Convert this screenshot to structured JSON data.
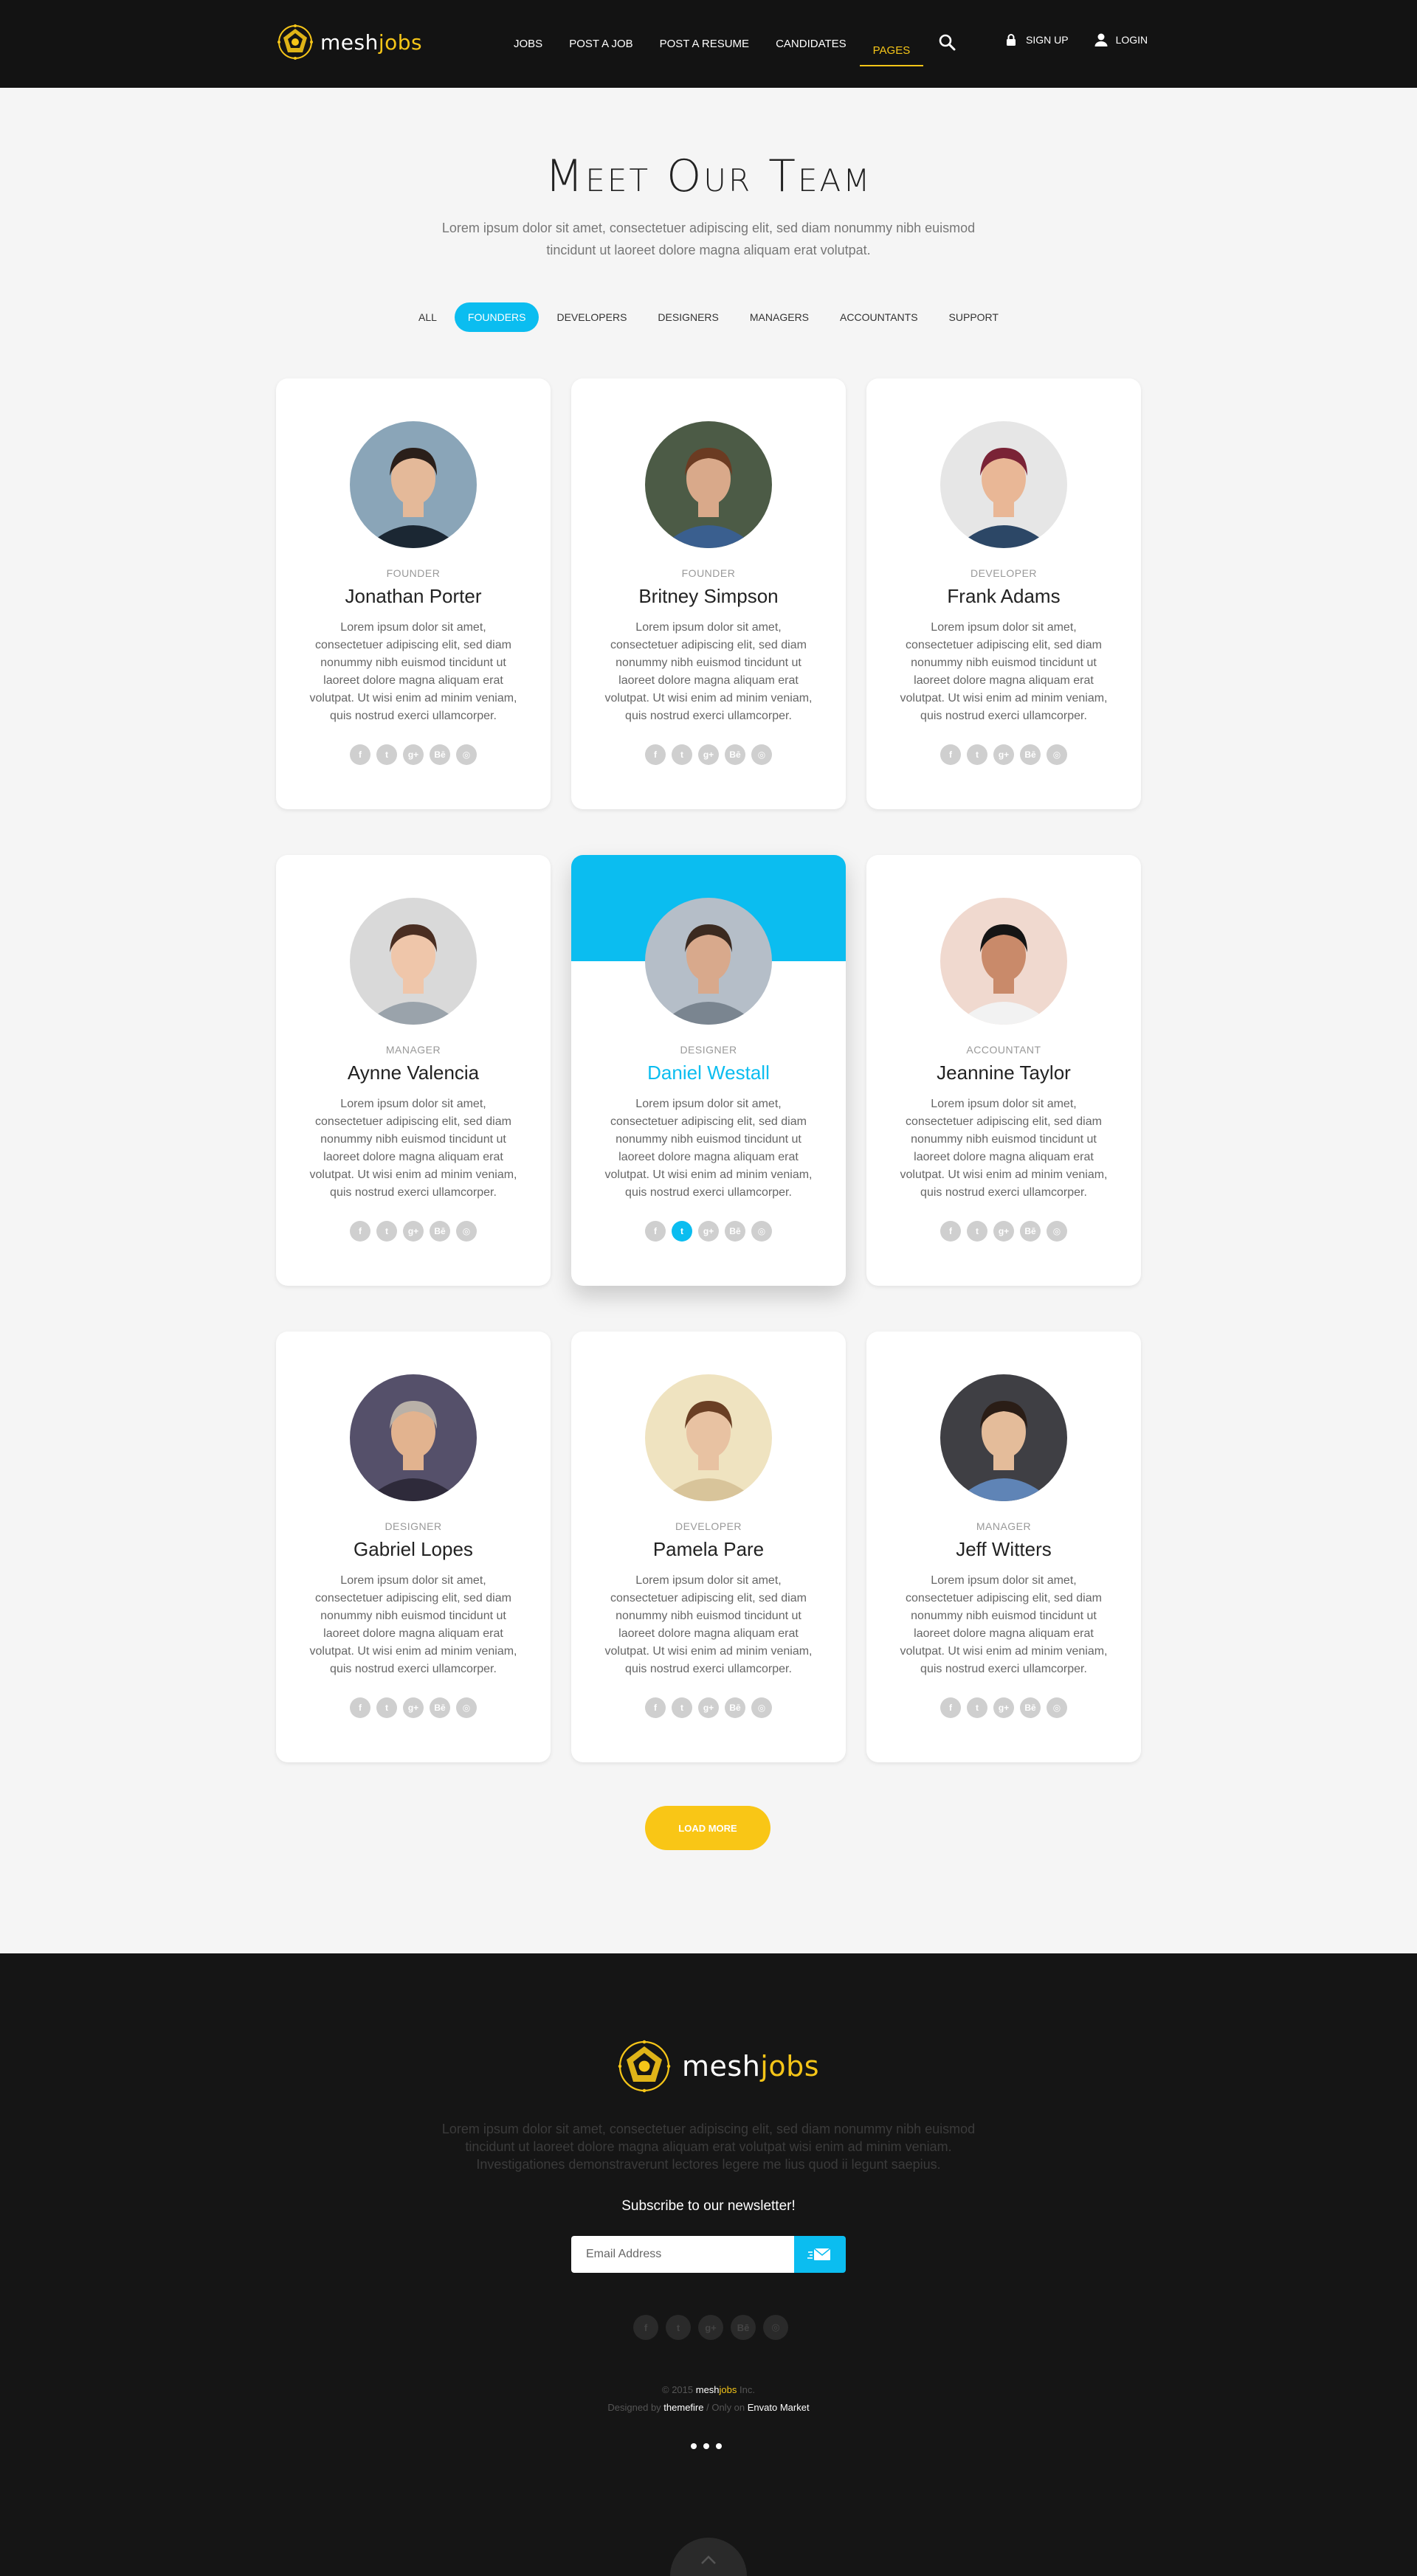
{
  "brand": {
    "name_a": "mesh",
    "name_b": "jobs",
    "accent": "#f5c518"
  },
  "nav": {
    "items": [
      {
        "label": "JOBS"
      },
      {
        "label": "POST A JOB"
      },
      {
        "label": "POST A RESUME"
      },
      {
        "label": "CANDIDATES"
      },
      {
        "label": "PAGES"
      }
    ],
    "active": "PAGES",
    "signup": "SIGN UP",
    "login": "LOGIN"
  },
  "hero": {
    "title": "Meet Our Team",
    "intro": "Lorem ipsum dolor sit amet, consectetuer adipiscing elit, sed diam nonummy nibh euismod tincidunt ut laoreet dolore magna aliquam erat volutpat."
  },
  "filters": [
    "ALL",
    "FOUNDERS",
    "DEVELOPERS",
    "DESIGNERS",
    "MANAGERS",
    "ACCOUNTANTS",
    "SUPPORT"
  ],
  "active_filter": "FOUNDERS",
  "team": [
    {
      "role": "FOUNDER",
      "name": "Jonathan Porter",
      "bio": "Lorem ipsum dolor sit amet, consectetuer adipiscing elit, sed diam nonummy nibh euismod tincidunt ut laoreet dolore magna aliquam erat volutpat. Ut wisi enim ad minim veniam, quis nostrud exerci ullamcorper."
    },
    {
      "role": "FOUNDER",
      "name": "Britney Simpson",
      "bio": "Lorem ipsum dolor sit amet, consectetuer adipiscing elit, sed diam nonummy nibh euismod tincidunt ut laoreet dolore magna aliquam erat volutpat. Ut wisi enim ad minim veniam, quis nostrud exerci ullamcorper."
    },
    {
      "role": "DEVELOPER",
      "name": "Frank Adams",
      "bio": "Lorem ipsum dolor sit amet, consectetuer adipiscing elit, sed diam nonummy nibh euismod tincidunt ut laoreet dolore magna aliquam erat volutpat. Ut wisi enim ad minim veniam, quis nostrud exerci ullamcorper."
    },
    {
      "role": "MANAGER",
      "name": "Aynne Valencia",
      "bio": "Lorem ipsum dolor sit amet, consectetuer adipiscing elit, sed diam nonummy nibh euismod tincidunt ut laoreet dolore magna aliquam erat volutpat. Ut wisi enim ad minim veniam, quis nostrud exerci ullamcorper."
    },
    {
      "role": "DESIGNER",
      "name": "Daniel Westall",
      "bio": "Lorem ipsum dolor sit amet, consectetuer adipiscing elit, sed diam nonummy nibh euismod tincidunt ut laoreet dolore magna aliquam erat volutpat. Ut wisi enim ad minim veniam, quis nostrud exerci ullamcorper."
    },
    {
      "role": "ACCOUNTANT",
      "name": "Jeannine Taylor",
      "bio": "Lorem ipsum dolor sit amet, consectetuer adipiscing elit, sed diam nonummy nibh euismod tincidunt ut laoreet dolore magna aliquam erat volutpat. Ut wisi enim ad minim veniam, quis nostrud exerci ullamcorper."
    },
    {
      "role": "DESIGNER",
      "name": "Gabriel Lopes",
      "bio": "Lorem ipsum dolor sit amet, consectetuer adipiscing elit, sed diam nonummy nibh euismod tincidunt ut laoreet dolore magna aliquam erat volutpat. Ut wisi enim ad minim veniam, quis nostrud exerci ullamcorper."
    },
    {
      "role": "DEVELOPER",
      "name": "Pamela Pare",
      "bio": "Lorem ipsum dolor sit amet, consectetuer adipiscing elit, sed diam nonummy nibh euismod tincidunt ut laoreet dolore magna aliquam erat volutpat. Ut wisi enim ad minim veniam, quis nostrud exerci ullamcorper."
    },
    {
      "role": "MANAGER",
      "name": "Jeff Witters",
      "bio": "Lorem ipsum dolor sit amet, consectetuer adipiscing elit, sed diam nonummy nibh euismod tincidunt ut laoreet dolore magna aliquam erat volutpat. Ut wisi enim ad minim veniam, quis nostrud exerci ullamcorper."
    }
  ],
  "featured_member": "Daniel Westall",
  "social_icons": [
    "facebook-icon",
    "twitter-icon",
    "google-plus-icon",
    "behance-icon",
    "dribbble-icon"
  ],
  "load_more": "LOAD MORE",
  "footer": {
    "text": "Lorem ipsum dolor sit amet, consectetuer adipiscing elit, sed diam nonummy nibh euismod tincidunt ut laoreet dolore magna aliquam erat volutpat wisi enim ad minim veniam. Investigationes demonstraverunt lectores legere me lius quod ii legunt saepius.",
    "subscribe": "Subscribe to our newsletter!",
    "email_placeholder": "Email Address",
    "copy_a": "© 2015 ",
    "copy_brand_a": "mesh",
    "copy_brand_b": "jobs",
    "copy_b": " Inc.",
    "designed_by": "Designed by ",
    "designer": "themefire",
    "separator": "  /  ",
    "only_on": "Only on ",
    "market": "Envato Market"
  },
  "colors": {
    "primary": "#0bbdf0",
    "accent": "#f9c616",
    "header_bg": "#131313",
    "footer_bg": "#151515"
  }
}
